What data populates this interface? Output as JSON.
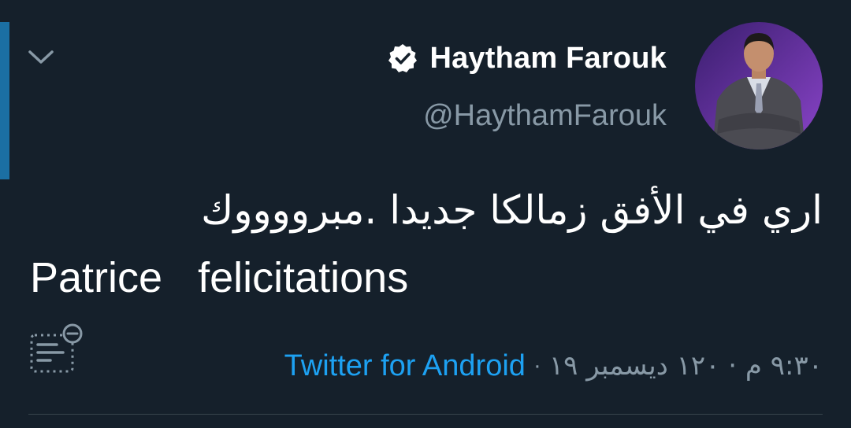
{
  "tweet": {
    "author": {
      "display_name": "Haytham Farouk",
      "handle": "@HaythamFarouk",
      "verified": true,
      "verified_icon": "verified-badge-icon",
      "avatar": "profile-photo"
    },
    "text_arabic": "اري في الأفق زمالكا جديدا .مبرووووك",
    "text_english": "Patrice   felicitations",
    "timestamp": "٩:٣٠ م · ١٢٠ ديسمبر ١٩",
    "separator": "·",
    "source": "Twitter for Android",
    "icons": {
      "menu": "chevron-down-icon",
      "translate": "translate-icon"
    }
  },
  "colors": {
    "background": "#15202b",
    "accent": "#1da1f2",
    "muted": "#8899a6",
    "left_bar": "#1b6fa3",
    "divider": "#38444d"
  }
}
